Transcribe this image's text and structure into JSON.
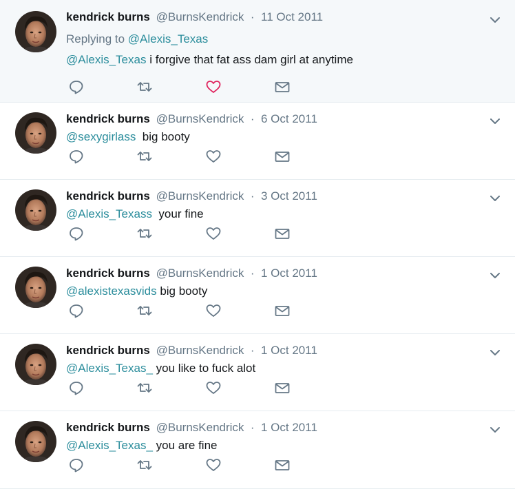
{
  "colors": {
    "link": "#2b8d9c",
    "muted": "#657786",
    "like_active": "#e0245e",
    "highlight_bg": "#f5f8fa"
  },
  "tweets": [
    {
      "name": "kendrick burns",
      "handle": "@BurnsKendrick",
      "date": "11 Oct 2011",
      "replying_prefix": "Replying to",
      "replying_to": "@Alexis_Texas",
      "mention": "@Alexis_Texas",
      "text": " i forgive that fat ass dam girl at anytime",
      "liked": true
    },
    {
      "name": "kendrick burns",
      "handle": "@BurnsKendrick",
      "date": "6 Oct 2011",
      "mention": "@sexygirlass",
      "text": "  big booty"
    },
    {
      "name": "kendrick burns",
      "handle": "@BurnsKendrick",
      "date": "3 Oct 2011",
      "mention": "@Alexis_Texass",
      "text": "  your fine"
    },
    {
      "name": "kendrick burns",
      "handle": "@BurnsKendrick",
      "date": "1 Oct 2011",
      "mention": "@alexistexasvids",
      "text": " big booty"
    },
    {
      "name": "kendrick burns",
      "handle": "@BurnsKendrick",
      "date": "1 Oct 2011",
      "mention": "@Alexis_Texas_",
      "text": " you like to fuck alot"
    },
    {
      "name": "kendrick burns",
      "handle": "@BurnsKendrick",
      "date": "1 Oct 2011",
      "mention": "@Alexis_Texas_",
      "text": " you are fine"
    }
  ],
  "separator": "·",
  "icons": {
    "reply": "reply-icon",
    "retweet": "retweet-icon",
    "like": "heart-icon",
    "dm": "envelope-icon",
    "more": "chevron-down-icon"
  }
}
